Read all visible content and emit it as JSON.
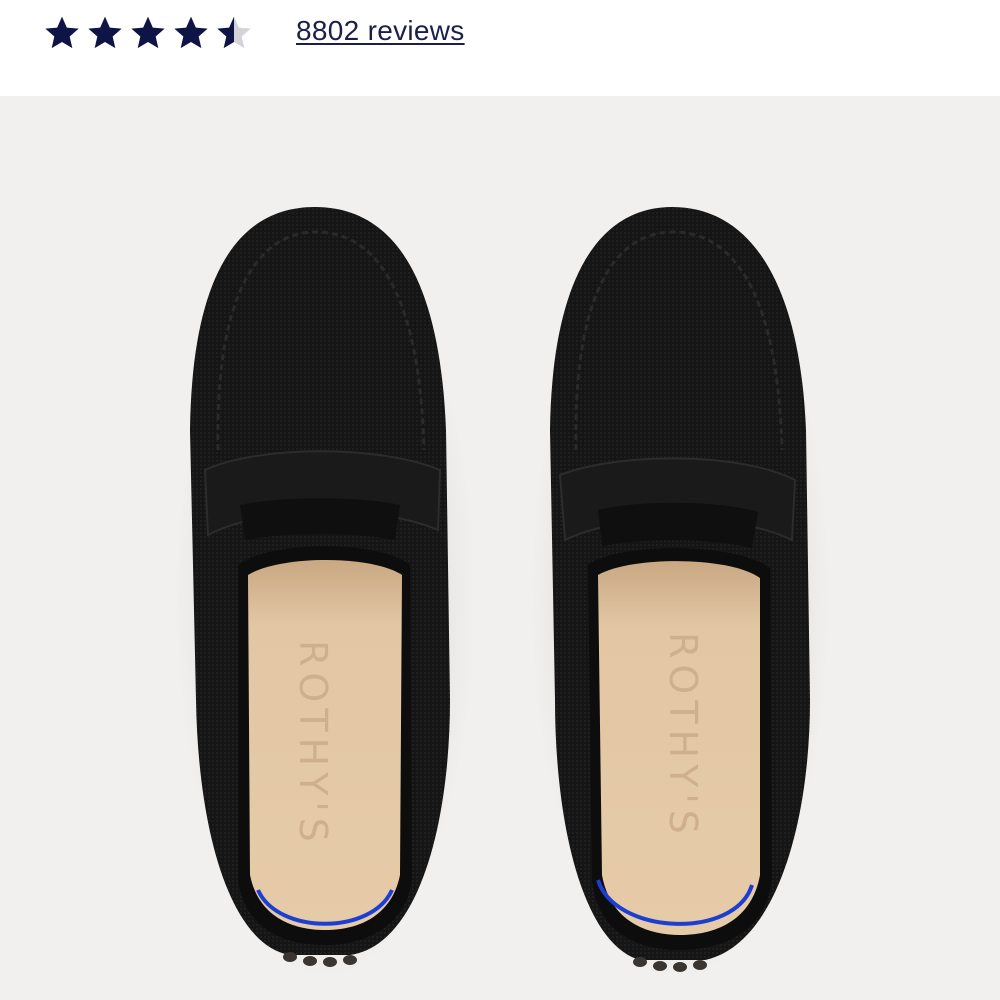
{
  "rating": {
    "value": 4.5,
    "max": 5,
    "reviews_label": "8802 reviews",
    "star_color": "#0e1445",
    "empty_star_color": "#d3d3d8"
  },
  "product_image": {
    "brand_mark": "ROTHY'S",
    "background_color": "#f1f0ee",
    "upper_color": "#141414",
    "insole_color": "#e3c7a5",
    "accent_color": "#1c3fd1"
  }
}
